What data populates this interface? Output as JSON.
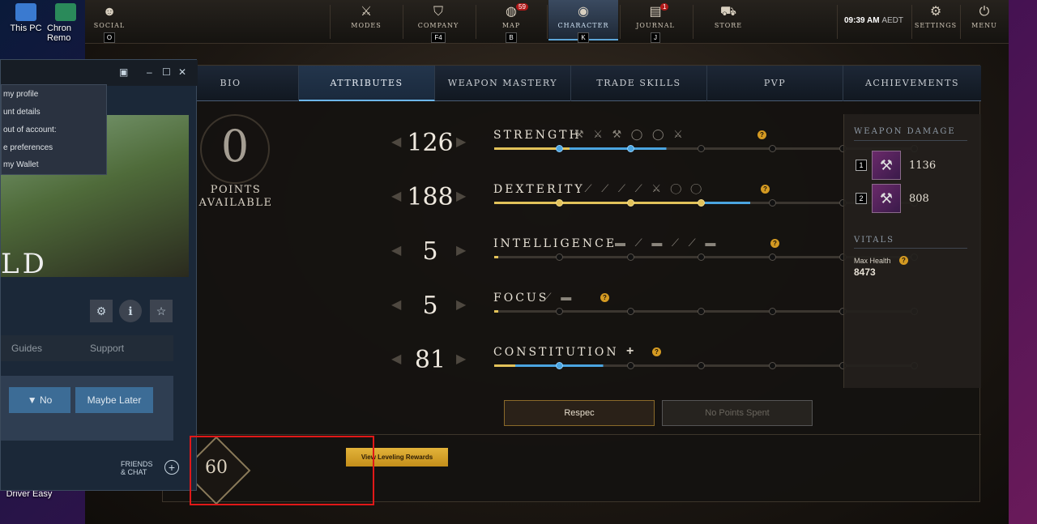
{
  "desktop": {
    "icons": [
      {
        "label": "This PC",
        "icon": "pc-icon"
      },
      {
        "label": "Chron Remo",
        "icon": "app-icon"
      },
      {
        "label": "Driver Easy",
        "icon": "app-icon"
      }
    ]
  },
  "nav": {
    "social": {
      "label": "SOCIAL",
      "key": "O"
    },
    "modes": {
      "label": "MODES"
    },
    "company": {
      "label": "COMPANY",
      "key": "F4"
    },
    "map": {
      "label": "MAP",
      "key": "B",
      "badge": "59"
    },
    "character": {
      "label": "CHARACTER",
      "key": "K"
    },
    "journal": {
      "label": "JOURNAL",
      "key": "J",
      "badge": "1"
    },
    "store": {
      "label": "STORE"
    },
    "time": "09:39 AM",
    "timezone": "AEDT",
    "settings": {
      "label": "SETTINGS"
    },
    "menu": {
      "label": "MENU"
    }
  },
  "tabs": [
    "BIO",
    "ATTRIBUTES",
    "WEAPON MASTERY",
    "TRADE SKILLS",
    "PVP",
    "ACHIEVEMENTS"
  ],
  "active_tab": "ATTRIBUTES",
  "points": {
    "value": "0",
    "label1": "POINTS",
    "label2": "AVAILABLE"
  },
  "attributes": [
    {
      "name": "STRENGTH",
      "value": "126",
      "plus": ""
    },
    {
      "name": "DEXTERITY",
      "value": "188",
      "plus": ""
    },
    {
      "name": "INTELLIGENCE",
      "value": "5",
      "plus": ""
    },
    {
      "name": "FOCUS",
      "value": "5",
      "plus": ""
    },
    {
      "name": "CONSTITUTION",
      "value": "81",
      "plus": "+"
    }
  ],
  "side": {
    "weapon_damage_title": "WEAPON DAMAGE",
    "slots": [
      {
        "num": "1",
        "value": "1136"
      },
      {
        "num": "2",
        "value": "808"
      }
    ],
    "vitals_title": "VITALS",
    "max_health_label": "Max Health",
    "max_health_value": "8473"
  },
  "buttons": {
    "respec": "Respec",
    "no_points": "No Points Spent"
  },
  "level": {
    "value": "60",
    "rewards_label": "View Leveling Rewards"
  },
  "steam": {
    "menu_items": [
      "my profile",
      "unt details",
      "out of account:",
      "e preferences",
      "my Wallet"
    ],
    "art_logo": "LD",
    "tabs": [
      "Guides",
      "Support"
    ],
    "review": {
      "no": "No",
      "later": "Maybe Later"
    },
    "friends_line1": "FRIENDS",
    "friends_line2": "& CHAT"
  },
  "colors": {
    "accent_blue": "#4ba5e0",
    "gold": "#e2c25a",
    "highlight_red": "#e01818"
  }
}
